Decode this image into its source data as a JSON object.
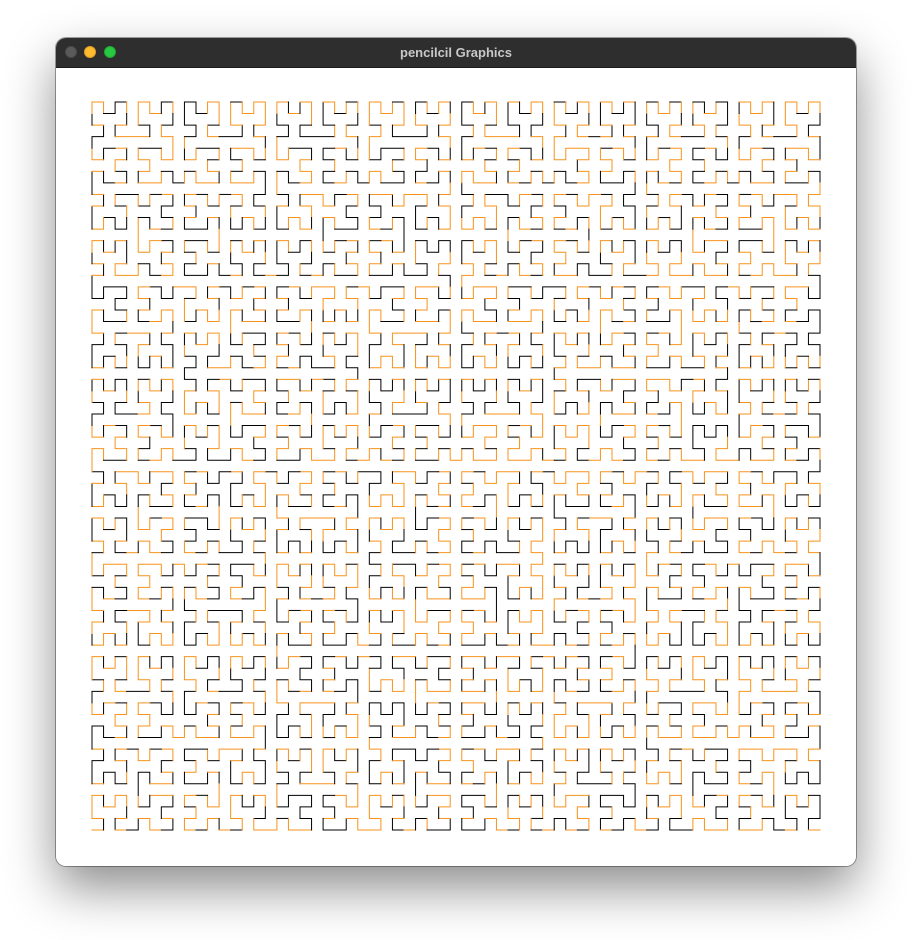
{
  "window": {
    "title": "pencilcil Graphics"
  },
  "drawing": {
    "type": "hilbert-curve",
    "order": 6,
    "colors": {
      "primary": "#000000",
      "accent": "#f7931e",
      "background": "#ffffff"
    },
    "icons": {
      "close": "close-icon",
      "minimize": "minimize-icon",
      "maximize": "maximize-icon"
    }
  }
}
